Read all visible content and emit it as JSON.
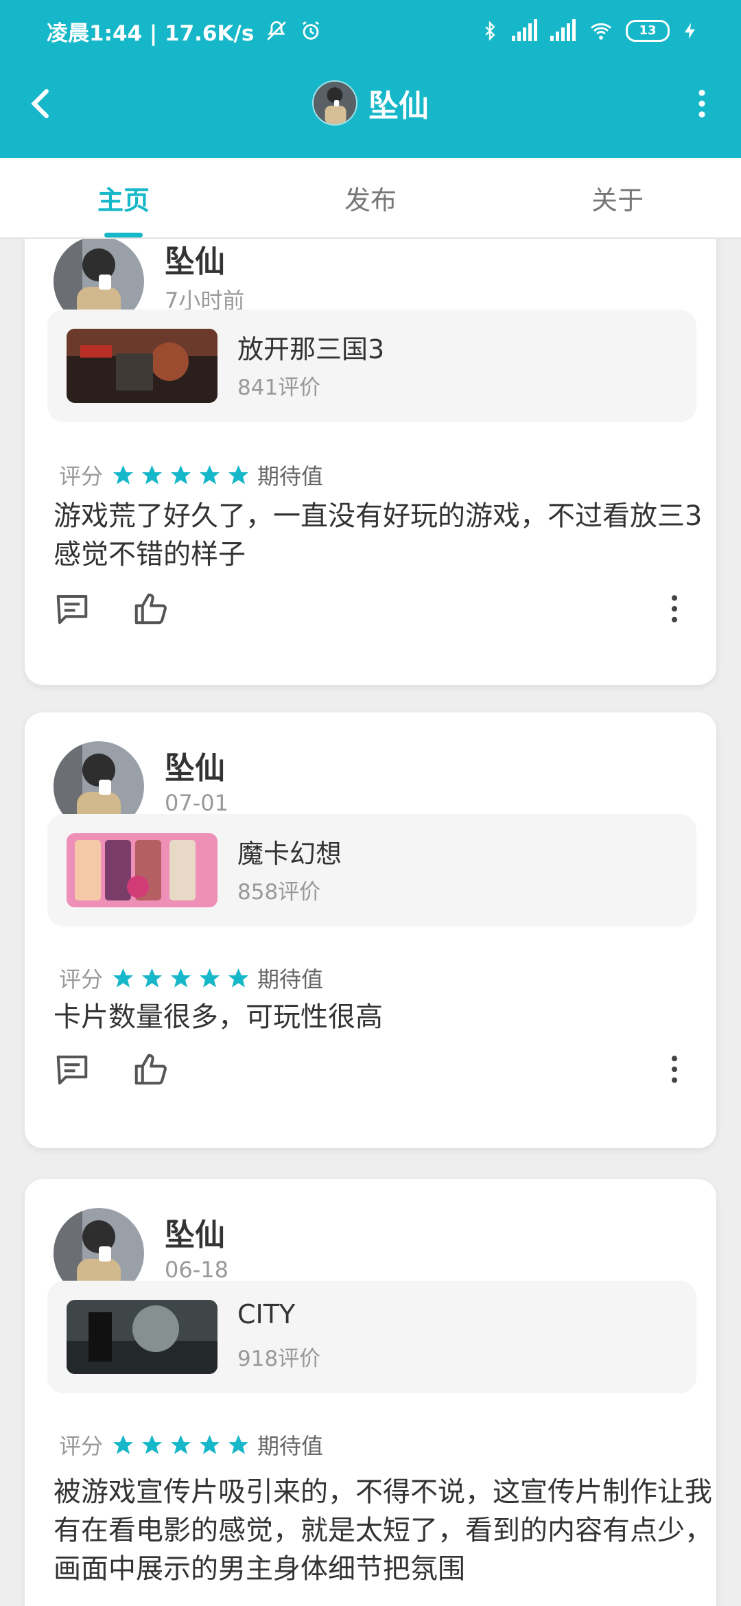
{
  "status_bar": {
    "time_speed": "凌晨1:44 | 17.6K/s",
    "battery": "13",
    "icons": [
      "mute-icon",
      "alarm-icon",
      "bluetooth-icon",
      "hd-signal-icon",
      "signal-icon",
      "wifi-icon",
      "battery-icon",
      "charging-icon"
    ]
  },
  "header": {
    "title": "坠仙",
    "back_icon": "back-arrow-icon",
    "more_icon": "more-vertical-icon"
  },
  "tabs": [
    {
      "label": "主页",
      "active": true
    },
    {
      "label": "发布",
      "active": false
    },
    {
      "label": "关于",
      "active": false
    }
  ],
  "reviews": [
    {
      "author": "坠仙",
      "time": "7小时前",
      "game": {
        "title": "放开那三国3",
        "reviews": "841评价"
      },
      "rating_label": "评分",
      "stars": 5,
      "rating_value": "期待值",
      "text": "游戏荒了好久了，一直没有好玩的游戏，不过看放三3感觉不错的样子"
    },
    {
      "author": "坠仙",
      "time": "07-01",
      "game": {
        "title": "魔卡幻想",
        "reviews": "858评价"
      },
      "rating_label": "评分",
      "stars": 5,
      "rating_value": "期待值",
      "text": "卡片数量很多，可玩性很高"
    },
    {
      "author": "坠仙",
      "time": "06-18",
      "game": {
        "title": "CITY",
        "reviews": "918评价"
      },
      "rating_label": "评分",
      "stars": 5,
      "rating_value": "期待值",
      "text": "被游戏宣传片吸引来的，不得不说，这宣传片制作让我有在看电影的感觉，就是太短了，看到的内容有点少，画面中展示的男主身体细节把氛围"
    }
  ],
  "colors": {
    "accent": "#16b7c8",
    "text_primary": "#333333",
    "text_secondary": "#999999",
    "background": "#eeeeee"
  }
}
